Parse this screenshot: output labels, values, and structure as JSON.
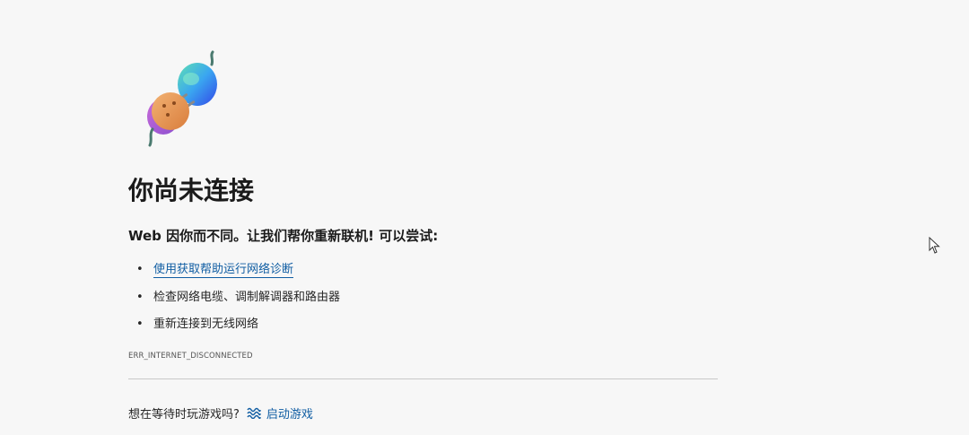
{
  "page": {
    "illustration_icon": "disconnected-plug-icon",
    "title": "你尚未连接",
    "subtitle": "Web 因你而不同。让我们帮你重新联机! 可以尝试:",
    "suggestions": [
      {
        "label": "使用获取帮助运行网络诊断",
        "link": true
      },
      {
        "label": "检查网络电缆、调制解调器和路由器",
        "link": false
      },
      {
        "label": "重新连接到无线网络",
        "link": false
      }
    ],
    "bullet": "•",
    "error_code": "ERR_INTERNET_DISCONNECTED",
    "game": {
      "prompt": "想在等待时玩游戏吗?",
      "icon": "surf-wave-icon",
      "link_label": "启动游戏"
    }
  },
  "colors": {
    "background": "#f7f7f7",
    "text": "#1b1b1b",
    "link": "#115ea3",
    "divider": "#c8c8c8"
  },
  "cursor_icon": "mouse-pointer-icon"
}
